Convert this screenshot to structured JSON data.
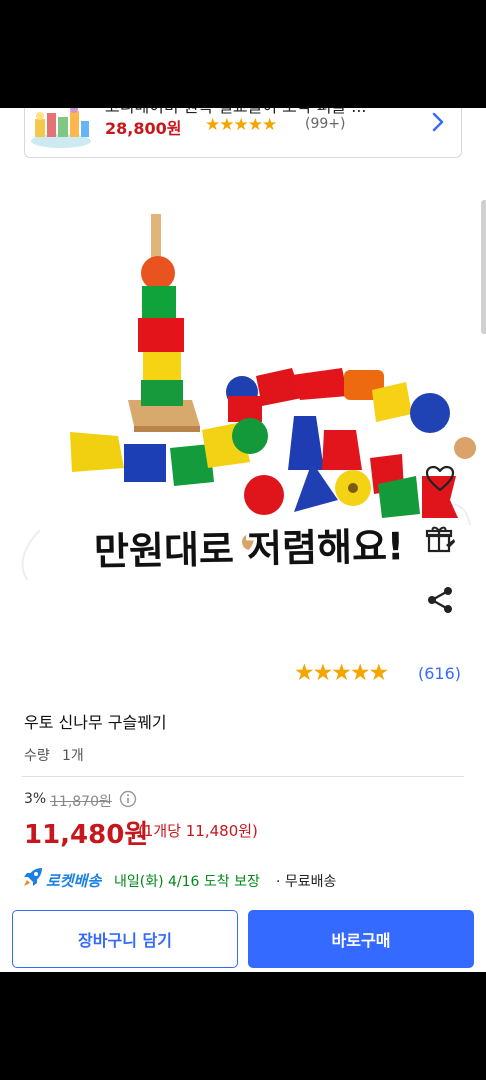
{
  "recommendation": {
    "title": "코니베이비 원목 칠교놀이 조각 퍼즐 ...",
    "price": "28,800원",
    "stars": "★★★★★",
    "review_count": "(99+)"
  },
  "image_caption": "만원대로 저렴해요!",
  "rating": {
    "stars": "★★★★★",
    "count": "(616)"
  },
  "product": {
    "name": "우토 신나무 구슬꿰기",
    "quantity_label": "수량",
    "quantity_value": "1개"
  },
  "pricing": {
    "discount": "3%",
    "original_price": "11,870원",
    "sale_price": "11,480원",
    "unit_price": "(1개당 11,480원)"
  },
  "delivery": {
    "badge": "로켓배송",
    "date": "내일(화) 4/16 도착 보장",
    "shipping": "· 무료배송"
  },
  "buttons": {
    "cart": "장바구니 담기",
    "buy": "바로구매"
  },
  "colors": {
    "accent": "#346aff",
    "price_red": "#c8171c",
    "star": "#f5a500",
    "delivery_green": "#00891a"
  },
  "icons": [
    "heart-icon",
    "gift-icon",
    "share-icon",
    "info-icon",
    "rocket-icon",
    "chevron-right-icon"
  ]
}
